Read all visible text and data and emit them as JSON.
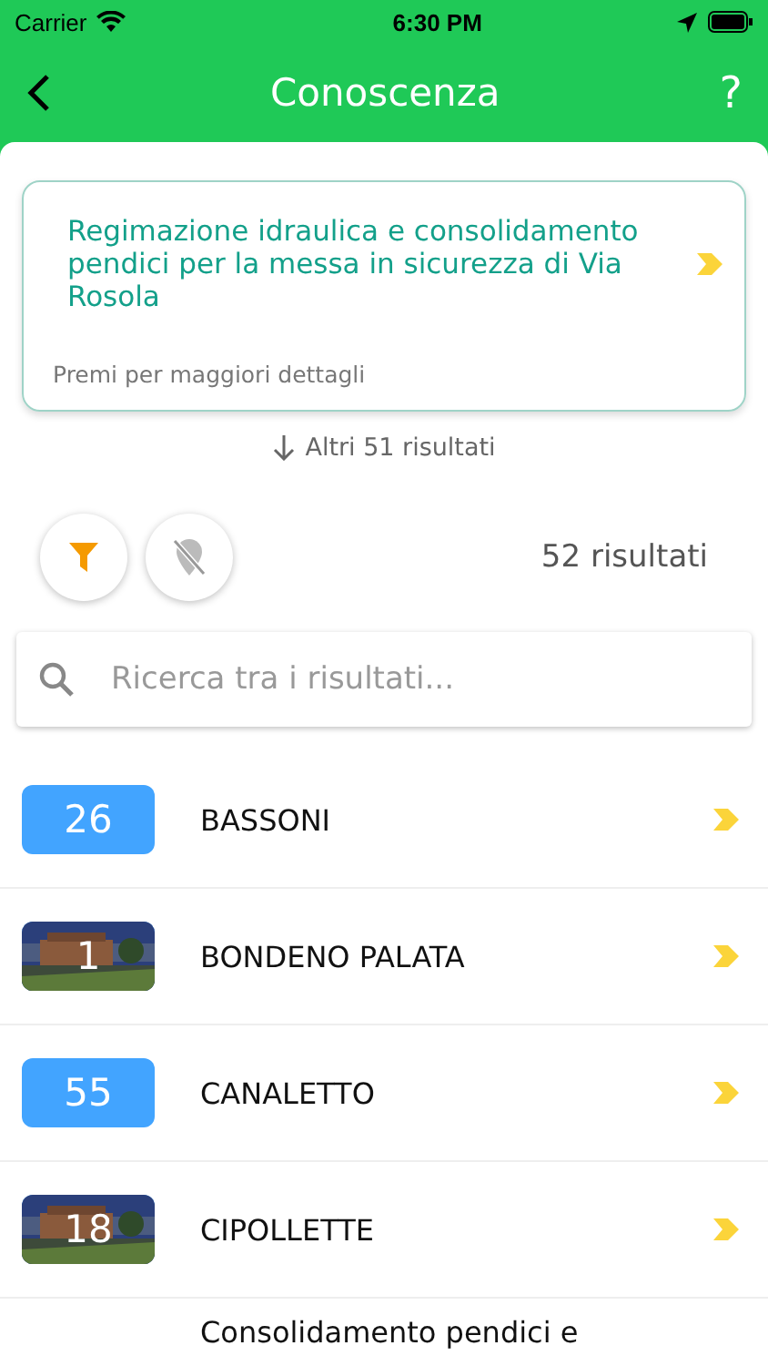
{
  "status_bar": {
    "carrier": "Carrier",
    "time": "6:30 PM"
  },
  "header": {
    "title": "Conoscenza",
    "help": "?"
  },
  "featured": {
    "title": "Regimazione idraulica e consolidamento pendici per la messa in sicurezza di Via Rosola",
    "hint": "Premi per maggiori dettagli"
  },
  "more_results": "Altri 51 risultati",
  "result_count": "52 risultati",
  "search": {
    "placeholder": "Ricerca tra i risultati..."
  },
  "items": [
    {
      "kind": "number",
      "number": "26",
      "name": "BASSONI"
    },
    {
      "number": "1",
      "name": "BONDENO PALATA"
    },
    {
      "kind": "number",
      "number": "55",
      "name": "CANALETTO"
    },
    {
      "number": "18",
      "name": "CIPOLLETTE"
    },
    {
      "kind": "text",
      "name": "Consolidamento pendici e"
    }
  ]
}
